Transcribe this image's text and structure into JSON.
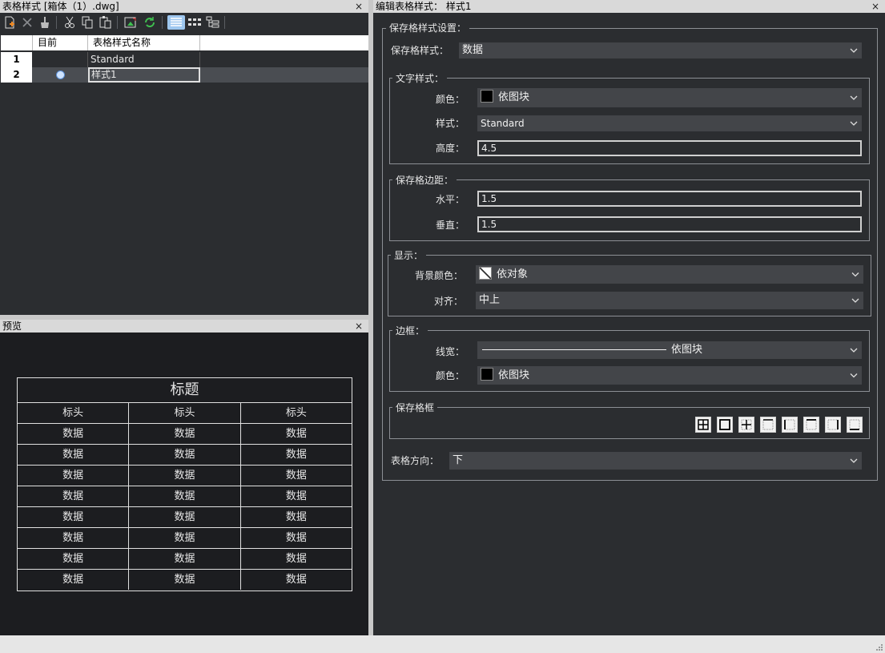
{
  "left_panel": {
    "title": "表格样式 [箱体（1）.dwg]",
    "close": "×",
    "toolbar": {
      "icons": [
        "new-style-icon",
        "delete-icon",
        "purge-icon",
        "cut-icon",
        "copy-icon",
        "paste-icon",
        "export-icon",
        "refresh-icon",
        "list-view-icon",
        "grid-view-icon",
        "tree-view-icon"
      ],
      "active": "list-view-icon"
    },
    "table": {
      "headers": [
        "",
        "目前",
        "表格样式名称"
      ],
      "rows": [
        {
          "index": "1",
          "current": false,
          "name": "Standard"
        },
        {
          "index": "2",
          "current": true,
          "name": "样式1"
        }
      ]
    }
  },
  "preview_panel": {
    "title": "预览",
    "close": "×",
    "table_title": "标题",
    "header_cells": [
      "标头",
      "标头",
      "标头"
    ],
    "data_cell": "数据",
    "data_rows": 8
  },
  "right_panel": {
    "title": "编辑表格样式：  样式1",
    "close": "×",
    "cell_style_settings": {
      "label": "保存格样式设置：",
      "cell_style_label": "保存格样式：",
      "cell_style_value": "数据"
    },
    "text_style": {
      "label": "文字样式：",
      "color_label": "颜色：",
      "color_value": "依图块",
      "style_label": "样式：",
      "style_value": "Standard",
      "height_label": "高度：",
      "height_value": "4.5"
    },
    "margins": {
      "label": "保存格边距：",
      "horizontal_label": "水平：",
      "horizontal_value": "1.5",
      "vertical_label": "垂直：",
      "vertical_value": "1.5"
    },
    "display": {
      "label": "显示：",
      "bg_label": "背景颜色：",
      "bg_value": "依对象",
      "align_label": "对齐：",
      "align_value": "中上"
    },
    "border": {
      "label": "边框：",
      "lineweight_label": "线宽：",
      "lineweight_value": "依图块",
      "color_label": "颜色：",
      "color_value": "依图块"
    },
    "cell_border": {
      "label": "保存格框",
      "buttons": [
        "all-borders-icon",
        "outside-border-icon",
        "inside-border-icon",
        "no-border-icon",
        "left-border-icon",
        "top-border-icon",
        "right-border-icon",
        "bottom-border-icon"
      ]
    },
    "direction_label": "表格方向：",
    "direction_value": "下"
  },
  "colors": {
    "bg": "#2b2d30",
    "header": "#d9d9d9",
    "combo": "#434549",
    "accent": "#9ec7ef"
  }
}
